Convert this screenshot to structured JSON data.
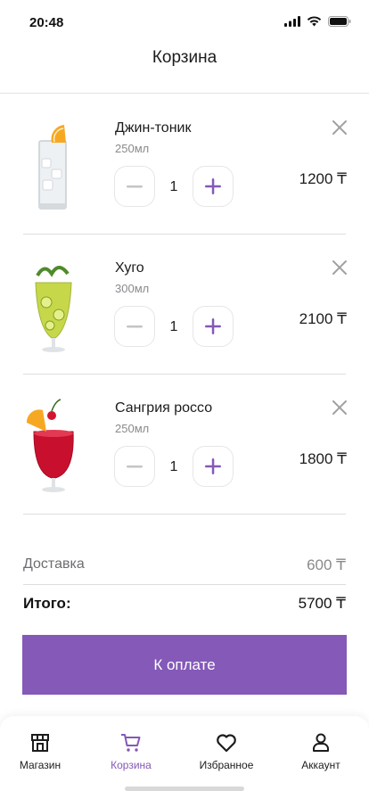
{
  "status_bar": {
    "time": "20:48"
  },
  "header": {
    "title": "Корзина"
  },
  "cart": {
    "items": [
      {
        "name": "Джин-тоник",
        "volume": "250мл",
        "quantity": "1",
        "price": "1200 ₸",
        "image_icon": "gin-tonic-icon"
      },
      {
        "name": "Хуго",
        "volume": "300мл",
        "quantity": "1",
        "price": "2100 ₸",
        "image_icon": "hugo-cocktail-icon"
      },
      {
        "name": "Сангрия россо",
        "volume": "250мл",
        "quantity": "1",
        "price": "1800 ₸",
        "image_icon": "sangria-icon"
      }
    ]
  },
  "summary": {
    "delivery_label": "Доставка",
    "delivery_value": "600 ₸",
    "total_label": "Итого:",
    "total_value": "5700 ₸"
  },
  "checkout": {
    "button_label": "К оплате"
  },
  "tab_bar": {
    "tabs": [
      {
        "label": "Магазин",
        "icon": "store-icon"
      },
      {
        "label": "Корзина",
        "icon": "cart-icon",
        "active": true
      },
      {
        "label": "Избранное",
        "icon": "heart-icon"
      },
      {
        "label": "Аккаунт",
        "icon": "user-icon"
      }
    ]
  },
  "colors": {
    "accent": "#8459b8",
    "text": "#1c1c1e",
    "muted": "#8a8a8e",
    "divider": "#dedede"
  }
}
